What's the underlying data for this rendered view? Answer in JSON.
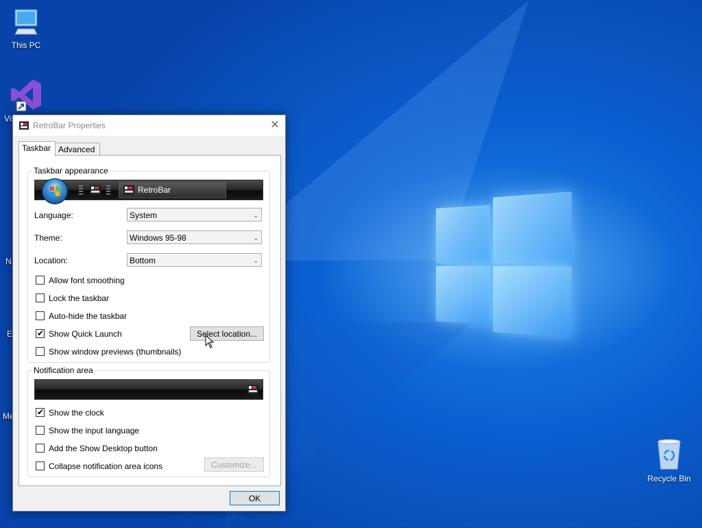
{
  "desktop": {
    "icons": [
      {
        "label": "This PC",
        "icon": "computer-icon"
      },
      {
        "label": "Vis",
        "icon": "visual-studio-icon"
      },
      {
        "label": "Recycle Bin",
        "icon": "recycle-bin-icon"
      }
    ],
    "edge_glyphs": [
      "N",
      "E",
      "Me"
    ]
  },
  "dialog": {
    "title": "RetroBar Properties",
    "close_glyph": "✕",
    "tabs": [
      {
        "label": "Taskbar",
        "active": true
      },
      {
        "label": "Advanced",
        "active": false
      }
    ],
    "taskbar_appearance": {
      "group_title": "Taskbar appearance",
      "preview_button_label": "RetroBar",
      "language": {
        "label": "Language:",
        "value": "System"
      },
      "theme": {
        "label": "Theme:",
        "value": "Windows 95-98"
      },
      "location": {
        "label": "Location:",
        "value": "Bottom"
      },
      "checkboxes": [
        {
          "label": "Allow font smoothing",
          "checked": false
        },
        {
          "label": "Lock the taskbar",
          "checked": false
        },
        {
          "label": "Auto-hide the taskbar",
          "checked": false
        },
        {
          "label": "Show Quick Launch",
          "checked": true
        },
        {
          "label": "Show window previews (thumbnails)",
          "checked": false
        }
      ],
      "select_location_label": "Select location..."
    },
    "notification_area": {
      "group_title": "Notification area",
      "checkboxes": [
        {
          "label": "Show the clock",
          "checked": true
        },
        {
          "label": "Show the input language",
          "checked": false
        },
        {
          "label": "Add the Show Desktop button",
          "checked": false
        },
        {
          "label": "Collapse notification area icons",
          "checked": false
        }
      ],
      "customize_label": "Customize..."
    },
    "ok_label": "OK"
  },
  "colors": {
    "accent": "#0078d7",
    "desktop_blue": "#0b5fd0"
  }
}
